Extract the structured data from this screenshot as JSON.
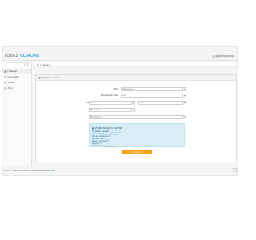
{
  "logo": {
    "part1": "TUBES ",
    "part2": "CLIRONE"
  },
  "user": {
    "name": "Администратор"
  },
  "sidebar": {
    "items": [
      {
        "label": "Главная",
        "icon": "home-icon"
      },
      {
        "label": "Настройки",
        "icon": "gear-icon"
      },
      {
        "label": "Меню",
        "icon": "list-icon"
      },
      {
        "label": "Логи",
        "icon": "list-icon"
      }
    ]
  },
  "breadcrumb": {
    "home": "Главная"
  },
  "panel": {
    "title": "Добавить заказ",
    "form": {
      "field1": {
        "label": "IDC",
        "value": "Выберите"
      },
      "field2": {
        "label": "Тарифный план",
        "value": "Не"
      },
      "field3": {
        "label": "Количество серверов и стоек",
        "value_a": "1",
        "value_b": "1"
      },
      "field4": {
        "label": "Тарифный план",
        "value": "Выберите"
      },
      "field5": {
        "label": "Период",
        "value": "Выберите"
      }
    },
    "info": {
      "title": "Информация о тарифе",
      "lines": [
        "Название тарифа: ____________",
        "Цена тарифа: ____________",
        "Кол-во серверов: 1",
        "Кол-во стоек: ____",
        "Итого к оплате: 0",
        "Период: 1",
        "Стоимость: ____________"
      ]
    },
    "submit_label": "Сохранить"
  },
  "footer": {
    "text": "2015 © Tubes Clirone. Все права защищены.",
    "link": "сайт"
  },
  "colors": {
    "accent": "#29abe2",
    "submit": "#f7a21b",
    "info_bg": "#d9edf7"
  }
}
